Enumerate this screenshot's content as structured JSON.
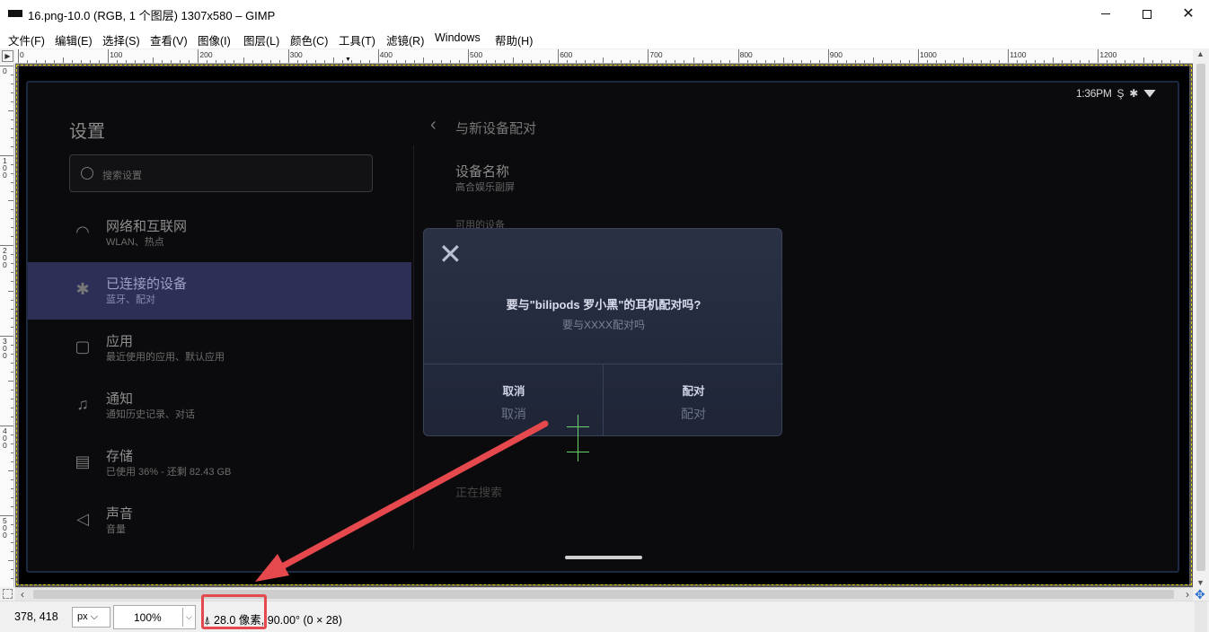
{
  "window": {
    "title": "16.png-10.0 (RGB, 1 个图层) 1307x580 – GIMP"
  },
  "menubar": {
    "items": [
      "文件(F)",
      "编辑(E)",
      "选择(S)",
      "查看(V)",
      "图像(I)",
      "图层(L)",
      "颜色(C)",
      "工具(T)",
      "滤镜(R)",
      "Windows",
      "帮助(H)"
    ]
  },
  "rulers": {
    "h_labels": [
      "0",
      "100",
      "200",
      "300",
      "400",
      "500",
      "600",
      "700",
      "800",
      "900",
      "1000",
      "1100",
      "1200"
    ],
    "v_labels": [
      "0",
      "100",
      "200",
      "300",
      "400",
      "500"
    ]
  },
  "device": {
    "status_time": "1:36PM",
    "settings_title": "设置",
    "search_placeholder": "搜索设置",
    "nav": [
      {
        "title": "网络和互联网",
        "sub": "WLAN、热点",
        "icon": "wifi-icon"
      },
      {
        "title": "已连接的设备",
        "sub": "蓝牙、配对",
        "icon": "bluetooth-icon"
      },
      {
        "title": "应用",
        "sub": "最近使用的应用、默认应用",
        "icon": "apps-icon"
      },
      {
        "title": "通知",
        "sub": "通知历史记录、对话",
        "icon": "bell-icon"
      },
      {
        "title": "存储",
        "sub": "已使用 36% - 还剩 82.43 GB",
        "icon": "storage-icon"
      },
      {
        "title": "声音",
        "sub": "音量",
        "icon": "sound-icon"
      }
    ],
    "pair_header": "与新设备配对",
    "device_name_label": "设备名称",
    "device_name_value": "高合娱乐副屏",
    "available_label": "可用的设备",
    "scan_label": "正在搜索"
  },
  "dialog": {
    "title": "要与\"bilipods 罗小黑\"的耳机配对吗?",
    "subtitle": "要与XXXX配对吗",
    "cancel_label": "取消",
    "pair_label": "配对",
    "cancel_ghost": "取消",
    "pair_ghost": "配对"
  },
  "statusbar": {
    "coords": "378, 418",
    "unit": "px",
    "zoom": "100",
    "zoom_suffix": "%",
    "measure": "28.0 像素, 90.00° (0 × 28)"
  },
  "colors": {
    "accent_active_nav": "#2d2f57",
    "highlight": "#e5484d",
    "guide": "#6bd36b",
    "selection_border": "#e8d300"
  }
}
